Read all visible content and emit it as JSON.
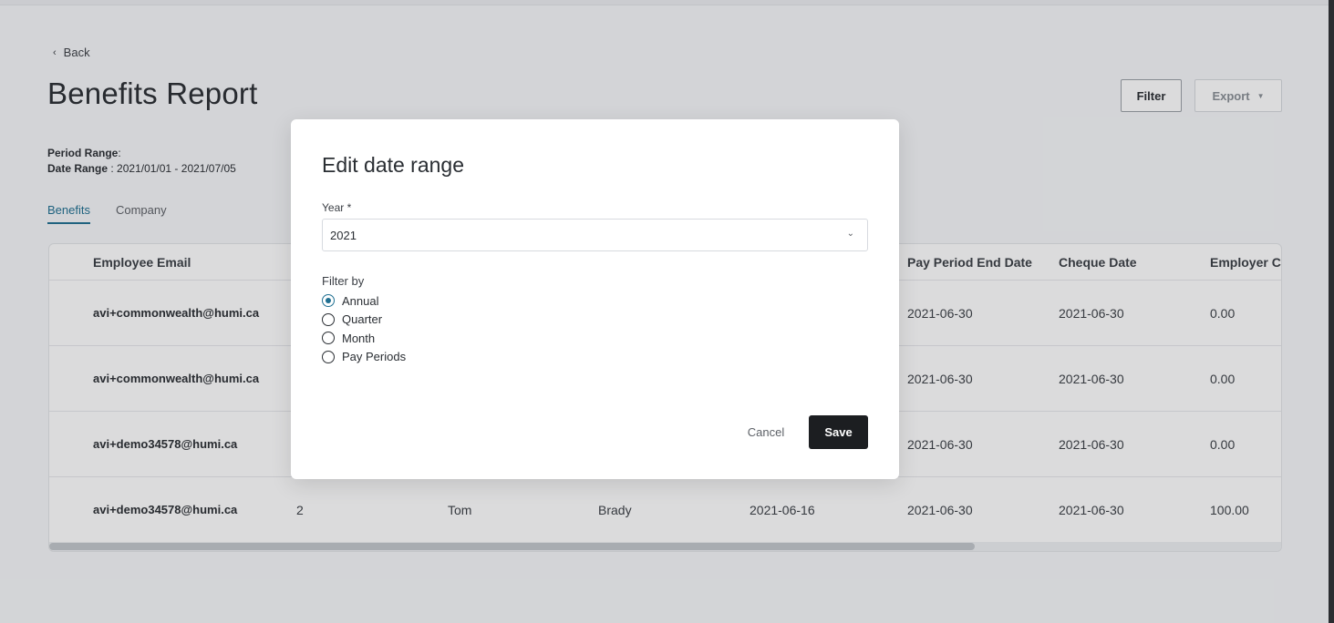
{
  "header": {
    "back_label": "Back",
    "title": "Benefits Report",
    "filter_label": "Filter",
    "export_label": "Export"
  },
  "meta": {
    "period_range_label": "Period Range",
    "period_range_value": ":",
    "date_range_label": "Date Range",
    "date_range_value": ": 2021/01/01 - 2021/07/05"
  },
  "tabs": [
    {
      "label": "Benefits",
      "active": true
    },
    {
      "label": "Company",
      "active": false
    }
  ],
  "table": {
    "columns": [
      "Employee Email",
      "Pay Period End Date",
      "Cheque Date",
      "Employer C"
    ],
    "rows": [
      {
        "email": "avi+commonwealth@humi.ca",
        "col2": "",
        "first": "",
        "last": "",
        "date1": "",
        "end": "2021-06-30",
        "cheque": "2021-06-30",
        "employer": "0.00"
      },
      {
        "email": "avi+commonwealth@humi.ca",
        "col2": "",
        "first": "",
        "last": "",
        "date1": "",
        "end": "2021-06-30",
        "cheque": "2021-06-30",
        "employer": "0.00"
      },
      {
        "email": "avi+demo34578@humi.ca",
        "col2": "",
        "first": "",
        "last": "",
        "date1": "",
        "end": "2021-06-30",
        "cheque": "2021-06-30",
        "employer": "0.00"
      },
      {
        "email": "avi+demo34578@humi.ca",
        "col2": "2",
        "first": "Tom",
        "last": "Brady",
        "date1": "2021-06-16",
        "end": "2021-06-30",
        "cheque": "2021-06-30",
        "employer": "100.00"
      }
    ]
  },
  "modal": {
    "title": "Edit date range",
    "year_label": "Year *",
    "year_value": "2021",
    "filter_by_label": "Filter by",
    "options": [
      {
        "label": "Annual",
        "checked": true
      },
      {
        "label": "Quarter",
        "checked": false
      },
      {
        "label": "Month",
        "checked": false
      },
      {
        "label": "Pay Periods",
        "checked": false
      }
    ],
    "cancel_label": "Cancel",
    "save_label": "Save"
  },
  "icons": {
    "back": "chevron-left-icon",
    "export_caret": "caret-down-icon",
    "select_caret": "chevron-down-icon"
  },
  "colors": {
    "accent": "#1f6f91",
    "save_button": "#1c1e21"
  }
}
